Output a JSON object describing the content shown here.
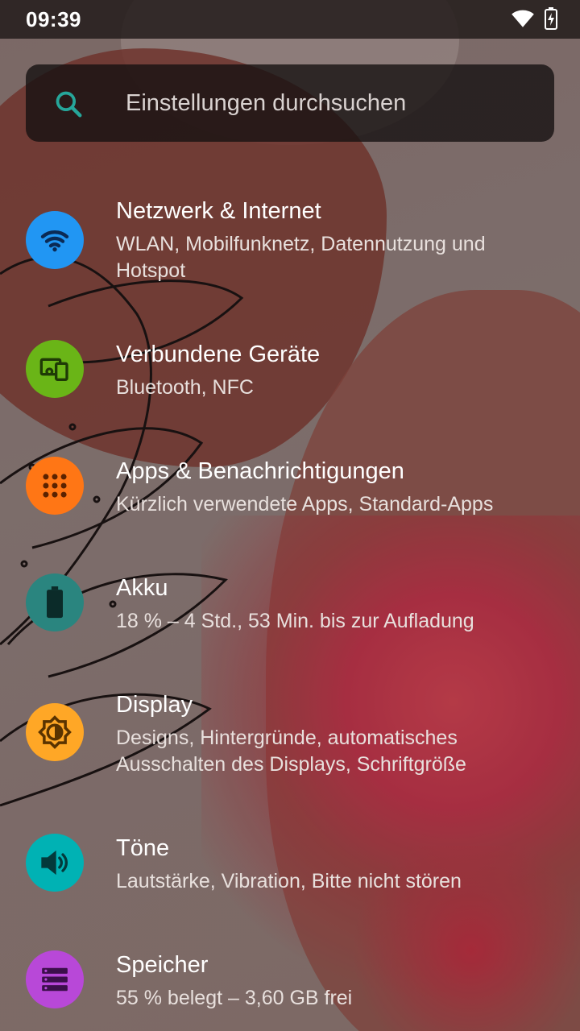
{
  "status_bar": {
    "time": "09:39",
    "icons": [
      "wifi-icon",
      "battery-charging-icon"
    ]
  },
  "search": {
    "placeholder": "Einstellungen durchsuchen",
    "icon": "search-icon"
  },
  "settings": [
    {
      "title": "Netzwerk & Internet",
      "subtitle": "WLAN, Mobilfunknetz, Datennutzung und Hotspot",
      "icon": "wifi-icon",
      "color": "#2196F3"
    },
    {
      "title": "Verbundene Geräte",
      "subtitle": "Bluetooth, NFC",
      "icon": "devices-icon",
      "color": "#6AB517"
    },
    {
      "title": "Apps & Benachrichtigungen",
      "subtitle": "Kürzlich verwendete Apps, Standard-Apps",
      "icon": "apps-grid-icon",
      "color": "#FF7615"
    },
    {
      "title": "Akku",
      "subtitle": "18 % – 4 Std., 53 Min. bis zur Aufladung",
      "icon": "battery-icon",
      "color": "#2A857F"
    },
    {
      "title": "Display",
      "subtitle": "Designs, Hintergründe, automatisches Ausschalten des Displays, Schriftgröße",
      "icon": "brightness-icon",
      "color": "#FFA726"
    },
    {
      "title": "Töne",
      "subtitle": "Lautstärke, Vibration, Bitte nicht stören",
      "icon": "volume-icon",
      "color": "#00B2B4"
    },
    {
      "title": "Speicher",
      "subtitle": "55 % belegt – 3,60 GB frei",
      "icon": "storage-icon",
      "color": "#B848D8"
    }
  ]
}
